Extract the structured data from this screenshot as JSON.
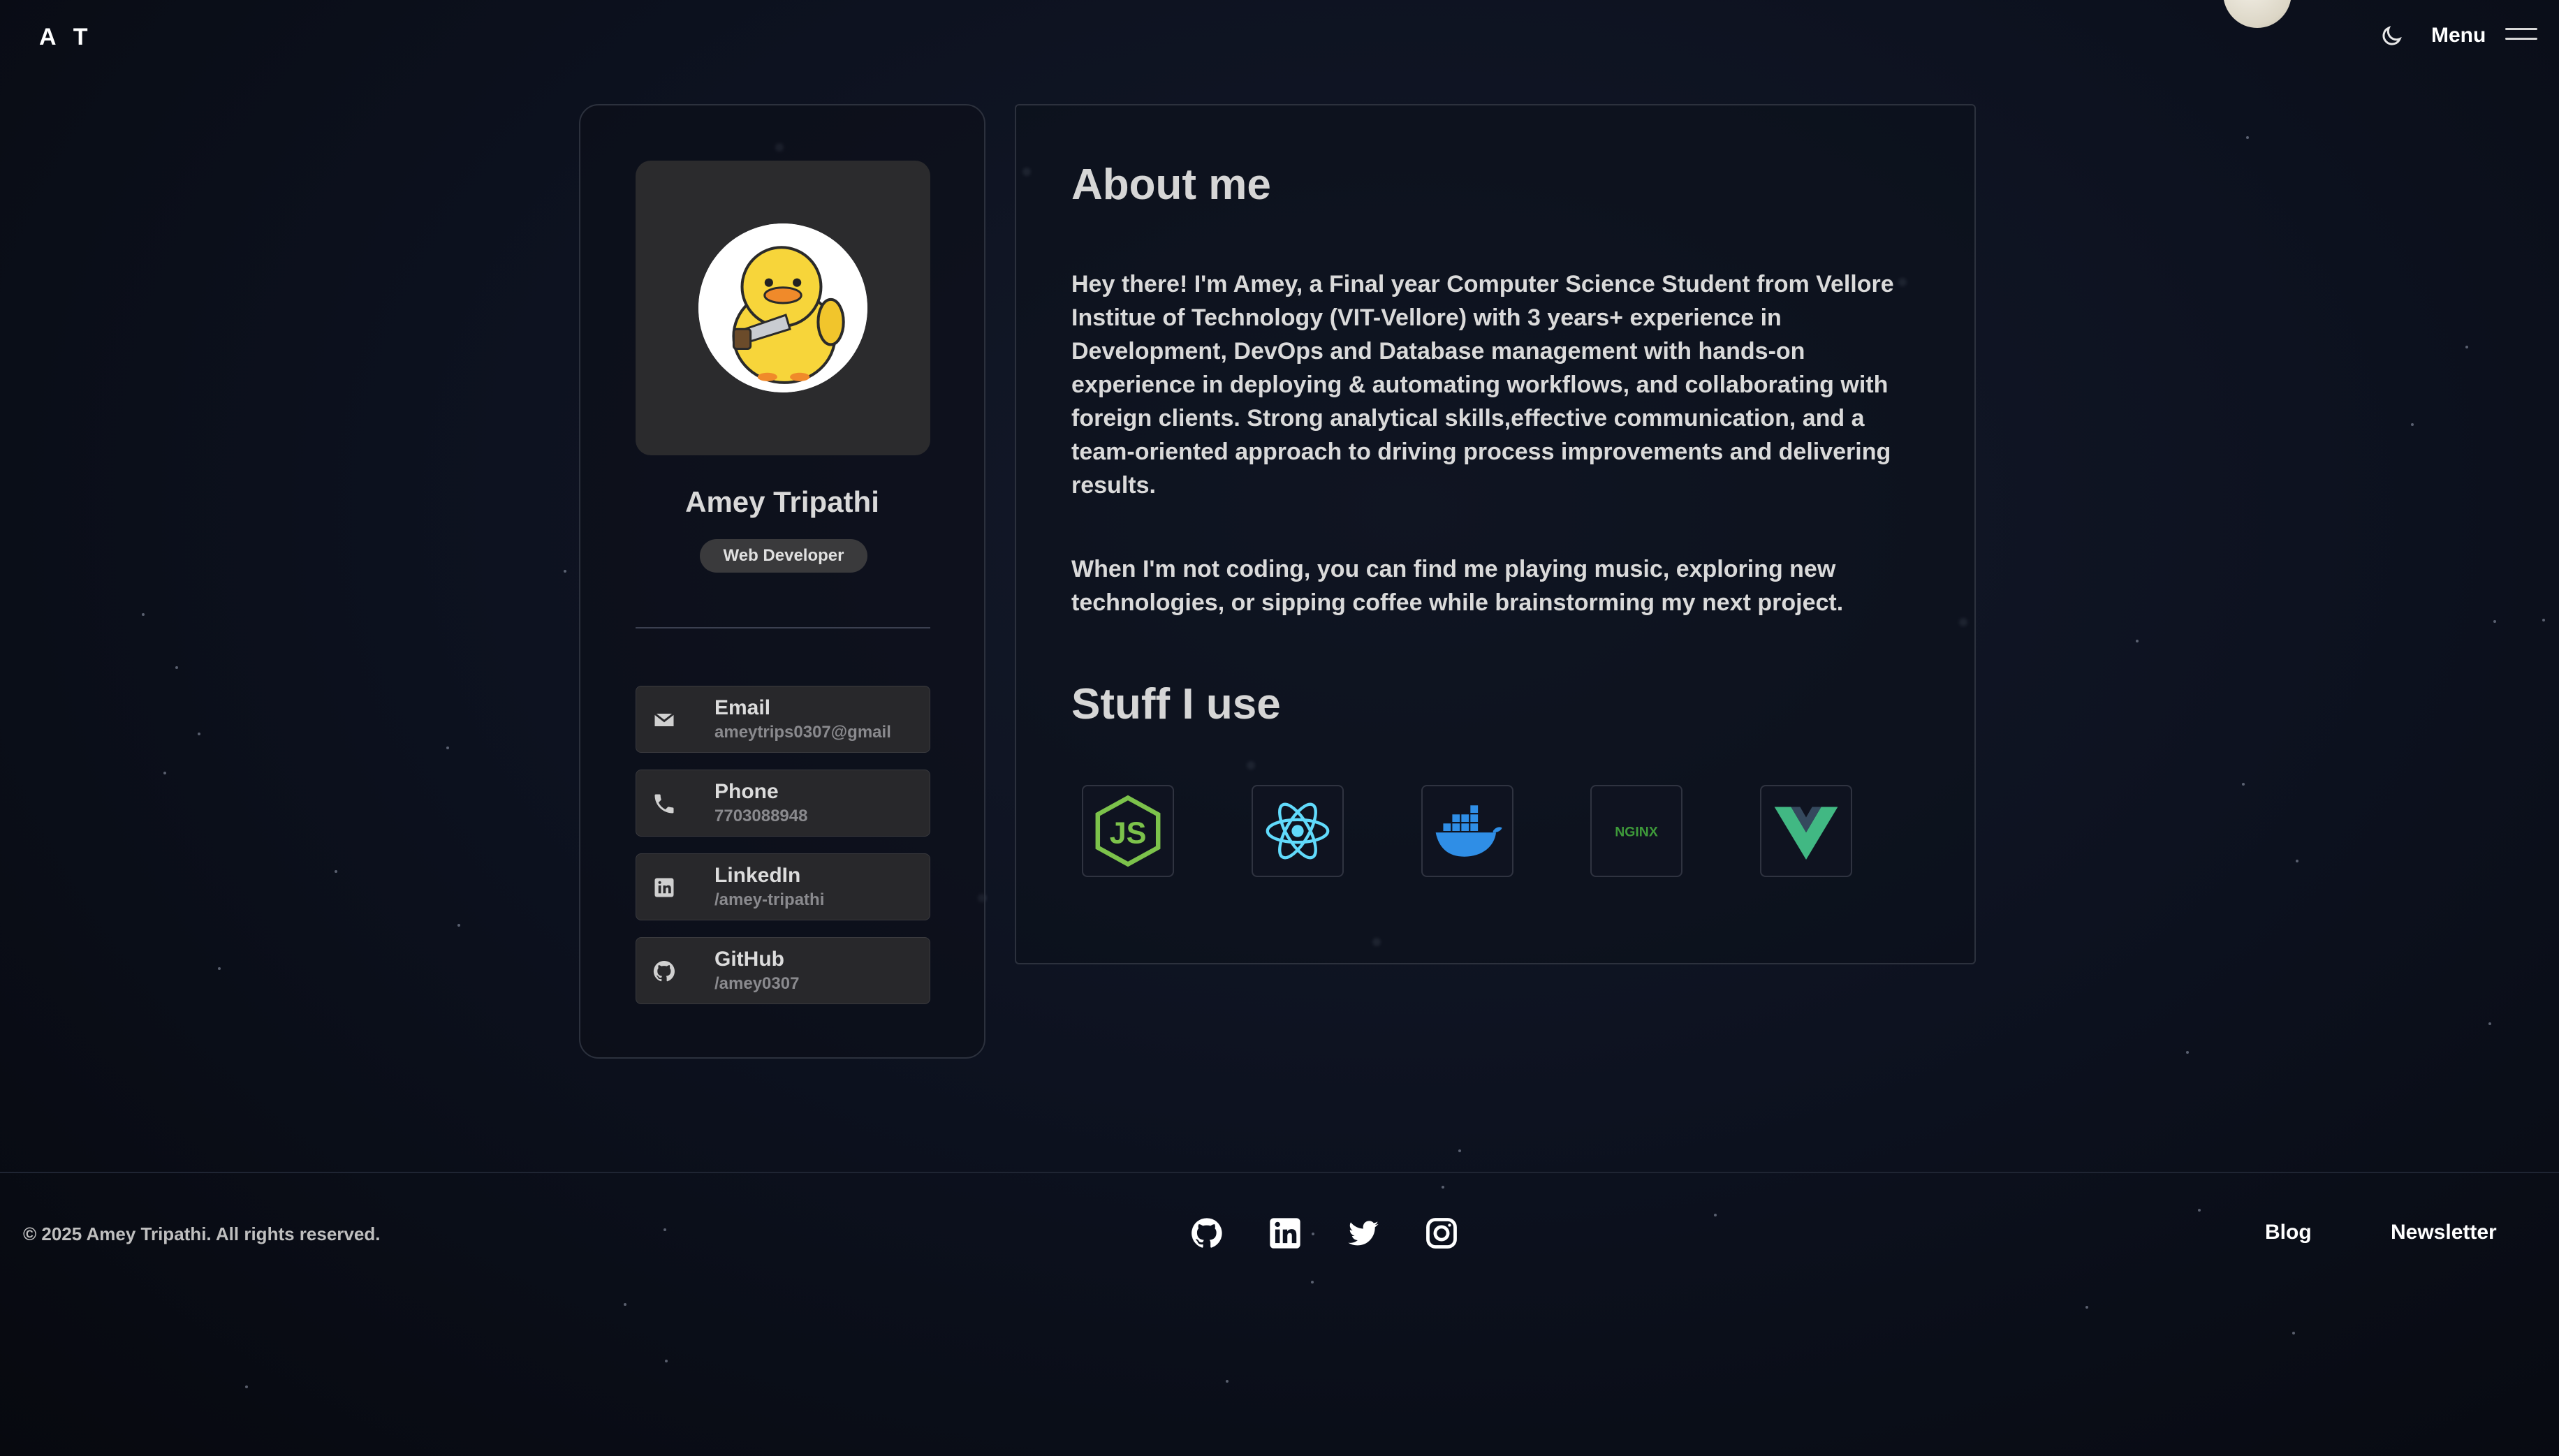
{
  "header": {
    "logo": "A T",
    "menu_label": "Menu"
  },
  "profile": {
    "name": "Amey Tripathi",
    "role": "Web Developer",
    "contacts": [
      {
        "label": "Email",
        "value": "ameytrips0307@gmail",
        "icon": "mail-icon"
      },
      {
        "label": "Phone",
        "value": "7703088948",
        "icon": "phone-icon"
      },
      {
        "label": "LinkedIn",
        "value": "/amey-tripathi",
        "icon": "linkedin-icon"
      },
      {
        "label": "GitHub",
        "value": "/amey0307",
        "icon": "github-icon"
      }
    ]
  },
  "about": {
    "title": "About me",
    "paragraphs": [
      "Hey there! I'm Amey, a Final year Computer Science Student from Vellore Institue of Technology (VIT-Vellore) with 3 years+ experience in Development, DevOps and Database management with hands-on experience in deploying & automating workflows, and collaborating with foreign clients. Strong analytical skills,effective communication, and a team-oriented approach to driving process improvements and delivering results.",
      "When I'm not coding, you can find me playing music, exploring new technologies, or sipping coffee while brainstorming my next project."
    ],
    "stuff_title": "Stuff I use",
    "tools": [
      {
        "name": "nodejs-icon",
        "color": "#7cc24b"
      },
      {
        "name": "react-icon",
        "color": "#61dafb"
      },
      {
        "name": "docker-icon",
        "color": "#2f8ee6"
      },
      {
        "name": "nginx-icon",
        "color": "#3e9a3a",
        "text": "NGINX"
      },
      {
        "name": "vue-icon",
        "color": "#41b883"
      }
    ]
  },
  "footer": {
    "copyright": "© 2025 Amey Tripathi. All rights reserved.",
    "socials": [
      "github-icon",
      "linkedin-icon",
      "twitter-icon",
      "instagram-icon"
    ],
    "links": [
      "Blog",
      "Newsletter"
    ]
  },
  "colors": {
    "background": "#0d1220",
    "card_border": "#2c313d",
    "text": "#dadada"
  }
}
